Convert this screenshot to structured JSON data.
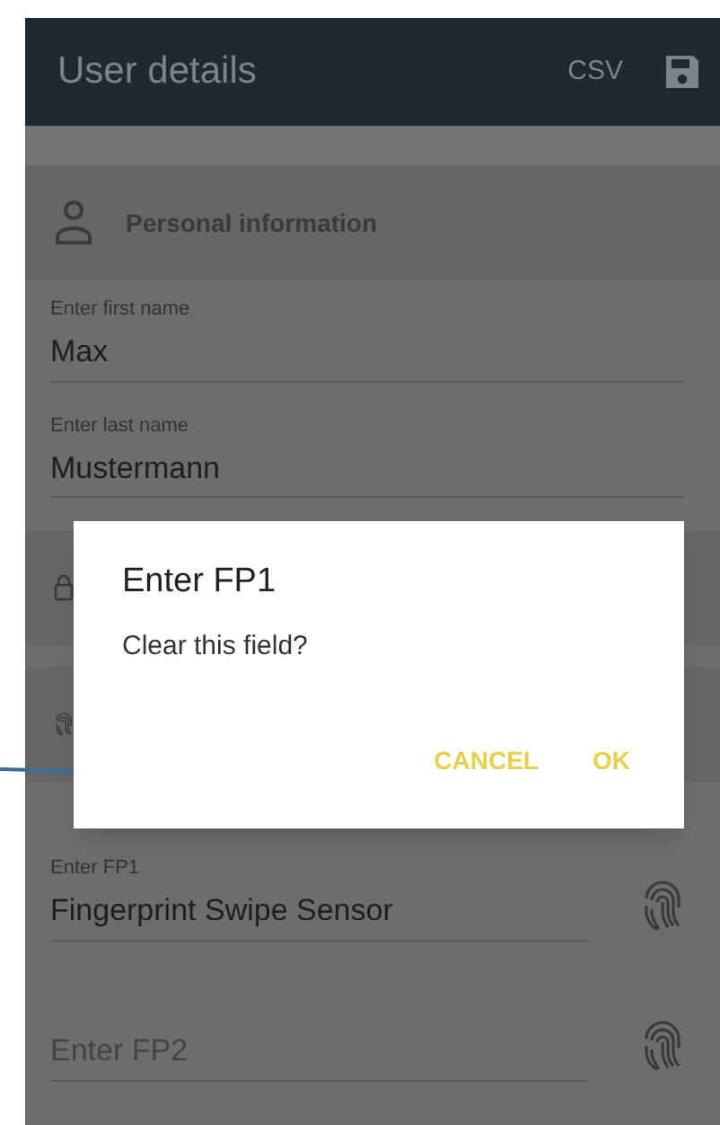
{
  "app_bar": {
    "title": "User details",
    "actions": [
      {
        "kind": "text",
        "label": "CSV"
      },
      {
        "kind": "save"
      }
    ]
  },
  "sections": [
    {
      "kind": "person",
      "title": "Personal information",
      "fields": [
        {
          "label": "Enter first name",
          "value": "Max"
        },
        {
          "label": "Enter last name",
          "value": "Mustermann"
        }
      ]
    },
    {
      "kind": "lock"
    },
    {
      "kind": "fingerprint",
      "fields": [
        {
          "label": "Enter FP1",
          "value": "Fingerprint Swipe Sensor"
        },
        {
          "placeholder": "Enter FP2"
        }
      ]
    }
  ],
  "dialog": {
    "title": "Enter FP1",
    "message": "Clear this field?",
    "buttons": [
      "CANCEL",
      "OK"
    ]
  }
}
